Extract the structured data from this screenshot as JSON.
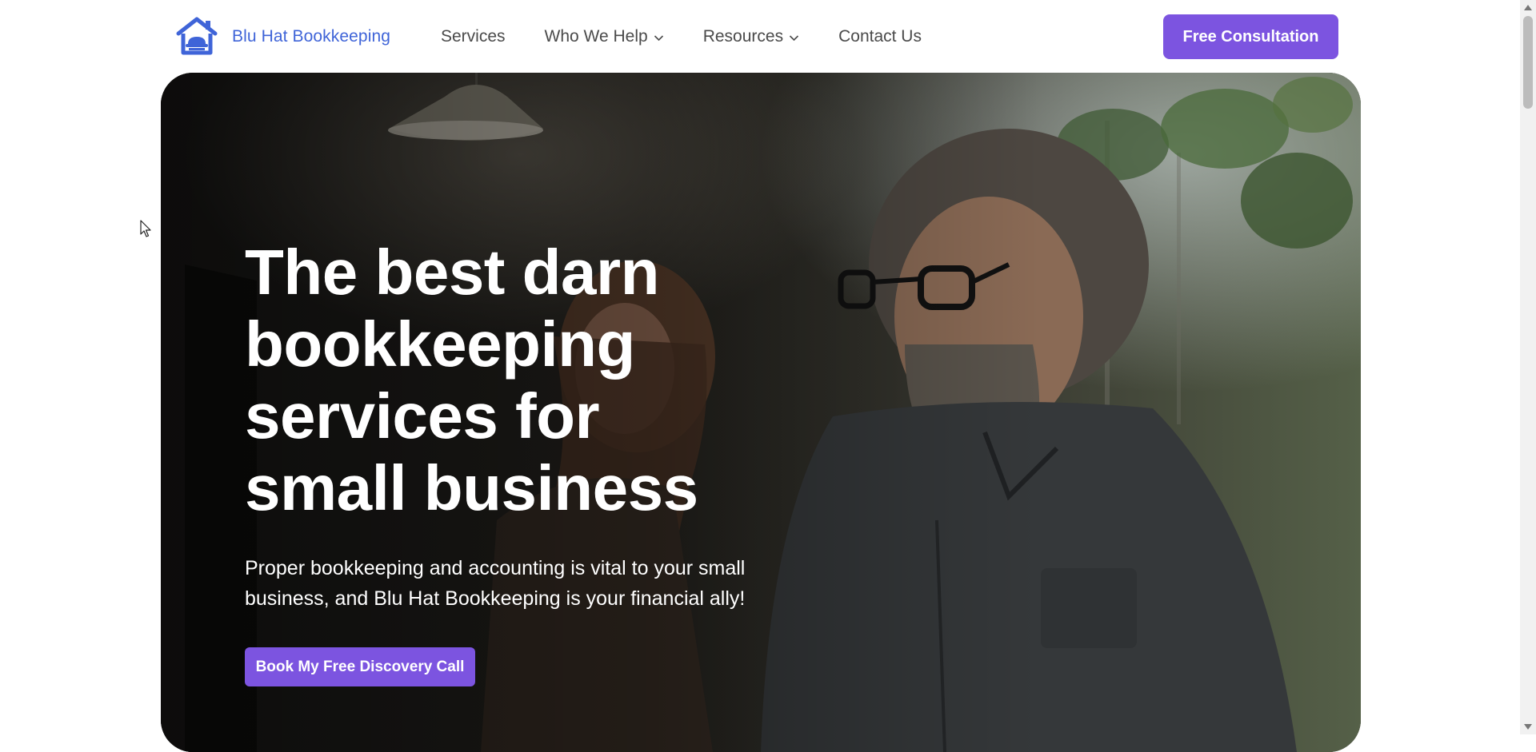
{
  "header": {
    "logo_text": "Blu Hat Bookkeeping",
    "logo_icon": "house-with-hat-icon",
    "brand_color": "#3f64d8",
    "nav": [
      {
        "label": "Services",
        "dropdown": false
      },
      {
        "label": "Who We Help",
        "dropdown": true
      },
      {
        "label": "Resources",
        "dropdown": true
      },
      {
        "label": "Contact Us",
        "dropdown": false
      }
    ],
    "cta_label": "Free Consultation"
  },
  "hero": {
    "title_lines": [
      "The best darn",
      "bookkeeping",
      "services for",
      "small business"
    ],
    "subtitle_lines": [
      "Proper bookkeeping and accounting is vital to your small",
      "business, and Blu Hat Bookkeeping is your financial ally!"
    ],
    "cta_label": "Book My Free Discovery Call"
  },
  "colors": {
    "accent": "#7c54e0",
    "hero_text": "#ffffff",
    "nav_text": "#4a4a4a"
  }
}
